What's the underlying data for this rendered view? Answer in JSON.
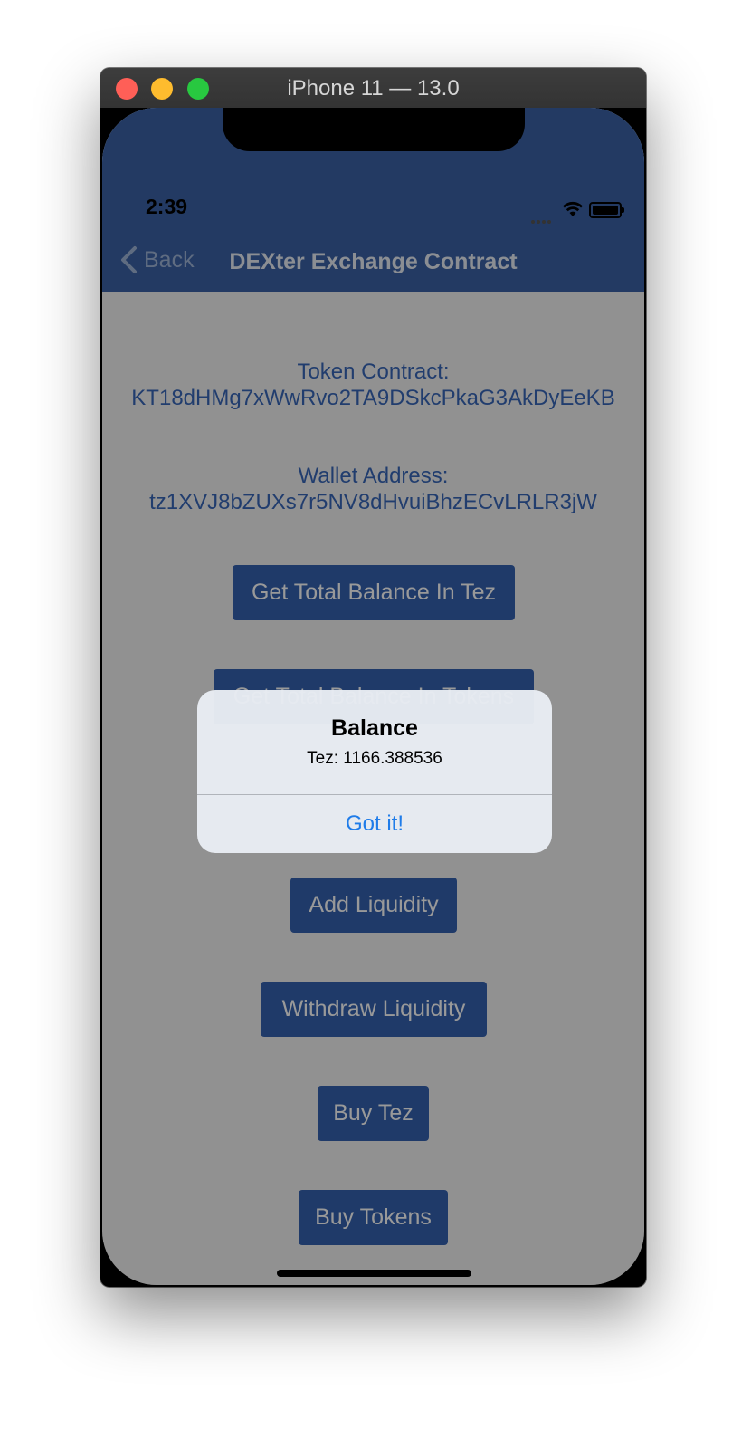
{
  "window": {
    "title": "iPhone 11 — 13.0"
  },
  "status_bar": {
    "time": "2:39"
  },
  "nav": {
    "back_label": "Back",
    "title": "DEXter Exchange Contract",
    "color": "#3b62a6"
  },
  "token_contract": {
    "label": "Token Contract:",
    "value": "KT18dHMg7xWwRvo2TA9DSkcPkaG3AkDyEeKB"
  },
  "wallet_address": {
    "label": "Wallet Address:",
    "value": "tz1XVJ8bZUXs7r5NV8dHvuiBhzECvLRLR3jW"
  },
  "buttons": [
    {
      "label": "Get Total Balance In Tez"
    },
    {
      "label": "Get Total Balance In Tokens"
    },
    {
      "label": "Add Liquidity"
    },
    {
      "label": "Withdraw Liquidity"
    },
    {
      "label": "Buy Tez"
    },
    {
      "label": "Buy Tokens"
    }
  ],
  "alert": {
    "title": "Balance",
    "message": "Tez: 1166.388536",
    "action": "Got it!"
  },
  "colors": {
    "accent": "#3562b0",
    "link": "#1f7ce9"
  }
}
